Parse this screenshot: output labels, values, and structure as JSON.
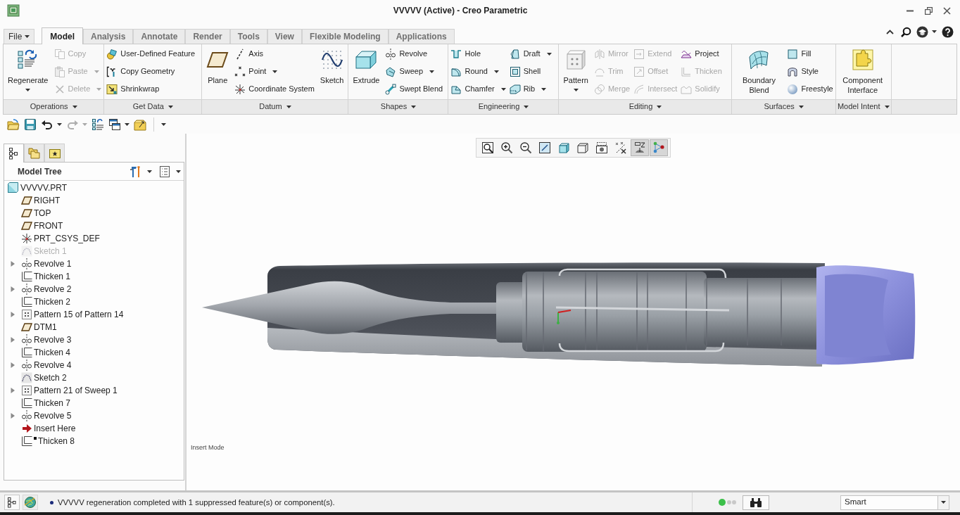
{
  "window": {
    "title": "VVVVV (Active) - Creo Parametric"
  },
  "ribbon": {
    "tabs": [
      {
        "label": "File",
        "selected": false,
        "dropdown": true
      },
      {
        "label": "Model",
        "selected": true
      },
      {
        "label": "Analysis",
        "selected": false
      },
      {
        "label": "Annotate",
        "selected": false
      },
      {
        "label": "Render",
        "selected": false
      },
      {
        "label": "Tools",
        "selected": false
      },
      {
        "label": "View",
        "selected": false
      },
      {
        "label": "Flexible Modeling",
        "selected": false
      },
      {
        "label": "Applications",
        "selected": false
      }
    ],
    "groups": [
      {
        "label": "Operations",
        "dropdown": true,
        "items": [
          {
            "kind": "large",
            "label": "Regenerate",
            "dropdown": true,
            "disabled": false
          },
          {
            "kind": "small",
            "label": "Copy",
            "dropdown": false,
            "disabled": true
          },
          {
            "kind": "small",
            "label": "Paste",
            "dropdown": true,
            "disabled": true
          },
          {
            "kind": "small",
            "label": "Delete",
            "dropdown": true,
            "disabled": true
          }
        ]
      },
      {
        "label": "Get Data",
        "dropdown": true,
        "items": [
          {
            "kind": "small",
            "label": "User-Defined Feature",
            "dropdown": false,
            "disabled": false
          },
          {
            "kind": "small",
            "label": "Copy Geometry",
            "dropdown": false,
            "disabled": false
          },
          {
            "kind": "small",
            "label": "Shrinkwrap",
            "dropdown": false,
            "disabled": false
          }
        ]
      },
      {
        "label": "Datum",
        "dropdown": true,
        "items": [
          {
            "kind": "large",
            "label": "Plane",
            "dropdown": false,
            "disabled": false
          },
          {
            "kind": "small",
            "label": "Axis",
            "dropdown": false,
            "disabled": false
          },
          {
            "kind": "small",
            "label": "Point",
            "dropdown": true,
            "disabled": false
          },
          {
            "kind": "small",
            "label": "Coordinate System",
            "dropdown": false,
            "disabled": false
          },
          {
            "kind": "large",
            "label": "Sketch",
            "dropdown": false,
            "disabled": false
          }
        ]
      },
      {
        "label": "Shapes",
        "dropdown": true,
        "items": [
          {
            "kind": "large",
            "label": "Extrude",
            "dropdown": false,
            "disabled": false
          },
          {
            "kind": "small",
            "label": "Revolve",
            "dropdown": false,
            "disabled": false
          },
          {
            "kind": "small",
            "label": "Sweep",
            "dropdown": true,
            "disabled": false
          },
          {
            "kind": "small",
            "label": "Swept Blend",
            "dropdown": false,
            "disabled": false
          }
        ]
      },
      {
        "label": "Engineering",
        "dropdown": true,
        "items": [
          {
            "kind": "small",
            "label": "Hole",
            "dropdown": false,
            "disabled": false
          },
          {
            "kind": "small",
            "label": "Round",
            "dropdown": true,
            "disabled": false
          },
          {
            "kind": "small",
            "label": "Chamfer",
            "dropdown": true,
            "disabled": false
          },
          {
            "kind": "small",
            "label": "Draft",
            "dropdown": true,
            "disabled": false
          },
          {
            "kind": "small",
            "label": "Shell",
            "dropdown": false,
            "disabled": false
          },
          {
            "kind": "small",
            "label": "Rib",
            "dropdown": true,
            "disabled": false
          }
        ]
      },
      {
        "label": "Editing",
        "dropdown": true,
        "items": [
          {
            "kind": "large",
            "label": "Pattern",
            "dropdown": true,
            "disabled": false
          },
          {
            "kind": "small",
            "label": "Mirror",
            "dropdown": false,
            "disabled": true
          },
          {
            "kind": "small",
            "label": "Trim",
            "dropdown": false,
            "disabled": true
          },
          {
            "kind": "small",
            "label": "Merge",
            "dropdown": false,
            "disabled": true
          },
          {
            "kind": "small",
            "label": "Extend",
            "dropdown": false,
            "disabled": true
          },
          {
            "kind": "small",
            "label": "Offset",
            "dropdown": false,
            "disabled": true
          },
          {
            "kind": "small",
            "label": "Intersect",
            "dropdown": false,
            "disabled": true
          },
          {
            "kind": "small",
            "label": "Project",
            "dropdown": false,
            "disabled": false
          },
          {
            "kind": "small",
            "label": "Thicken",
            "dropdown": false,
            "disabled": true
          },
          {
            "kind": "small",
            "label": "Solidify",
            "dropdown": false,
            "disabled": true
          }
        ]
      },
      {
        "label": "Surfaces",
        "dropdown": true,
        "items": [
          {
            "kind": "large",
            "label": "Boundary Blend",
            "dropdown": false,
            "disabled": false
          },
          {
            "kind": "small",
            "label": "Fill",
            "dropdown": false,
            "disabled": false
          },
          {
            "kind": "small",
            "label": "Style",
            "dropdown": false,
            "disabled": false
          },
          {
            "kind": "small",
            "label": "Freestyle",
            "dropdown": false,
            "disabled": false
          }
        ]
      },
      {
        "label": "Model Intent",
        "dropdown": true,
        "items": [
          {
            "kind": "large",
            "label": "Component Interface",
            "dropdown": false,
            "disabled": false
          }
        ]
      }
    ]
  },
  "quick_access": [
    {
      "kind": "open",
      "disabled": false,
      "dropdown": false
    },
    {
      "kind": "save",
      "disabled": false,
      "dropdown": false
    },
    {
      "kind": "undo",
      "disabled": false,
      "dropdown": true
    },
    {
      "kind": "redo",
      "disabled": true,
      "dropdown": true
    },
    {
      "kind": "regenerate",
      "disabled": false,
      "dropdown": false
    },
    {
      "kind": "windows",
      "disabled": false,
      "dropdown": true
    },
    {
      "kind": "close",
      "disabled": false,
      "dropdown": false
    }
  ],
  "model_tree": {
    "tabs": [
      {
        "kind": "model-tree",
        "selected": true
      },
      {
        "kind": "folder-browser",
        "selected": false
      },
      {
        "kind": "favorites",
        "selected": false
      }
    ],
    "title": "Model Tree",
    "root": {
      "label": "VVVVV.PRT",
      "kind": "part",
      "disabled": false,
      "children": [
        {
          "label": "RIGHT",
          "kind": "plane",
          "disabled": false
        },
        {
          "label": "TOP",
          "kind": "plane",
          "disabled": false
        },
        {
          "label": "FRONT",
          "kind": "plane",
          "disabled": false
        },
        {
          "label": "PRT_CSYS_DEF",
          "kind": "csys",
          "disabled": false
        },
        {
          "label": "Sketch 1",
          "kind": "sketch",
          "disabled": true
        },
        {
          "label": "Revolve 1",
          "kind": "revolve",
          "disabled": false,
          "expanded": false
        },
        {
          "label": "Thicken 1",
          "kind": "thicken",
          "disabled": false
        },
        {
          "label": "Revolve 2",
          "kind": "revolve",
          "disabled": false,
          "expanded": false
        },
        {
          "label": "Thicken 2",
          "kind": "thicken",
          "disabled": false
        },
        {
          "label": "Pattern 15 of Pattern 14",
          "kind": "pattern",
          "disabled": false,
          "expanded": false
        },
        {
          "label": "DTM1",
          "kind": "plane",
          "disabled": false
        },
        {
          "label": "Revolve 3",
          "kind": "revolve",
          "disabled": false,
          "expanded": false
        },
        {
          "label": "Thicken 4",
          "kind": "thicken",
          "disabled": false
        },
        {
          "label": "Revolve 4",
          "kind": "revolve",
          "disabled": false,
          "expanded": false
        },
        {
          "label": "Sketch 2",
          "kind": "sketch",
          "disabled": false
        },
        {
          "label": "Pattern 21 of Sweep 1",
          "kind": "pattern",
          "disabled": false,
          "expanded": false
        },
        {
          "label": "Thicken 7",
          "kind": "thicken",
          "disabled": false
        },
        {
          "label": "Revolve 5",
          "kind": "revolve",
          "disabled": false,
          "expanded": false
        },
        {
          "label": "Insert Here",
          "kind": "insert",
          "disabled": false
        },
        {
          "label": "Thicken 8",
          "kind": "thicken",
          "disabled": false,
          "marker": true
        }
      ]
    }
  },
  "viewport": {
    "toolbar": [
      {
        "kind": "refit",
        "on": false
      },
      {
        "kind": "zoom-in",
        "on": false
      },
      {
        "kind": "zoom-out",
        "on": false
      },
      {
        "kind": "repaint",
        "on": false
      },
      {
        "kind": "display-style",
        "on": false
      },
      {
        "kind": "saved-views",
        "on": false
      },
      {
        "kind": "camera",
        "on": false
      },
      {
        "kind": "datum-display",
        "on": false
      },
      {
        "kind": "spin-center",
        "on": true
      },
      {
        "kind": "node-link",
        "on": true
      }
    ],
    "mode": "Insert Mode"
  },
  "status_bar": {
    "message": "VVVVV regeneration completed with 1 suppressed feature(s) or component(s).",
    "filter": {
      "value": "Smart"
    }
  }
}
